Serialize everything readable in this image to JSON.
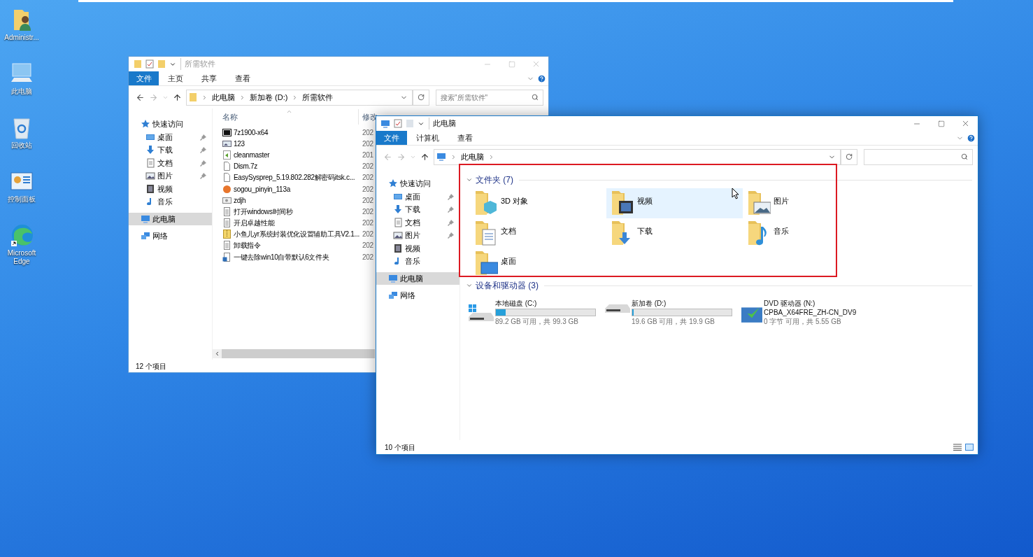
{
  "desktop_icons": [
    {
      "label": "Administr...",
      "kind": "user"
    },
    {
      "label": "此电脑",
      "kind": "computer"
    },
    {
      "label": "回收站",
      "kind": "trash"
    },
    {
      "label": "控制面板",
      "kind": "panel"
    },
    {
      "label": "Microsoft Edge",
      "kind": "edge"
    }
  ],
  "back_window": {
    "title": "所需软件",
    "active": false,
    "tabs": [
      {
        "label": "文件",
        "kind": "menu",
        "selected": false
      },
      {
        "label": "主页",
        "kind": "tab",
        "selected": false
      },
      {
        "label": "共享",
        "kind": "tab",
        "selected": false
      },
      {
        "label": "查看",
        "kind": "tab",
        "selected": false
      }
    ],
    "breadcrumb": [
      "此电脑",
      "新加卷 (D:)",
      "所需软件"
    ],
    "search_placeholder": "搜索\"所需软件\"",
    "nav": [
      {
        "label": "快速访问",
        "kind": "star",
        "selected": false,
        "children": [
          {
            "label": "桌面",
            "kind": "desktop",
            "pinned": true,
            "selected": false
          },
          {
            "label": "下载",
            "kind": "download",
            "pinned": true,
            "selected": false
          },
          {
            "label": "文档",
            "kind": "document",
            "pinned": true,
            "selected": false
          },
          {
            "label": "图片",
            "kind": "picture",
            "pinned": true,
            "selected": false
          },
          {
            "label": "视频",
            "kind": "video",
            "pinned": false,
            "selected": false
          },
          {
            "label": "音乐",
            "kind": "music",
            "pinned": false,
            "selected": false
          }
        ]
      },
      {
        "label": "此电脑",
        "kind": "computer",
        "selected": true
      },
      {
        "label": "网络",
        "kind": "network",
        "selected": false
      }
    ],
    "columns": [
      "名称",
      "修改"
    ],
    "files": [
      {
        "name": "7z1900-x64",
        "kind": "sevenzip",
        "date": "202"
      },
      {
        "name": "123",
        "kind": "image",
        "date": "202"
      },
      {
        "name": "cleanmaster",
        "kind": "installer",
        "date": "201"
      },
      {
        "name": "Dism.7z",
        "kind": "file",
        "date": "202"
      },
      {
        "name": "EasySysprep_5.19.802.282解密码itsk.c...",
        "kind": "file",
        "date": "202"
      },
      {
        "name": "sogou_pinyin_113a",
        "kind": "sogou",
        "date": "202"
      },
      {
        "name": "zdjh",
        "kind": "snapshot",
        "date": "202"
      },
      {
        "name": "打开windows时间秒",
        "kind": "text",
        "date": "202"
      },
      {
        "name": "开启卓越性能",
        "kind": "text",
        "date": "202"
      },
      {
        "name": "小鱼儿yr系统封装优化设置辅助工具V2.1...",
        "kind": "archive",
        "date": "202"
      },
      {
        "name": "卸载指令",
        "kind": "text",
        "date": "202"
      },
      {
        "name": "一键去除win10自带默认6文件夹",
        "kind": "script",
        "date": "202"
      }
    ],
    "status": "12 个项目"
  },
  "front_window": {
    "title": "此电脑",
    "active": true,
    "tabs": [
      {
        "label": "文件",
        "kind": "menu",
        "selected": false
      },
      {
        "label": "计算机",
        "kind": "tab",
        "selected": false
      },
      {
        "label": "查看",
        "kind": "tab",
        "selected": false
      }
    ],
    "breadcrumb": [
      "此电脑"
    ],
    "nav": [
      {
        "label": "快速访问",
        "kind": "star",
        "selected": false,
        "children": [
          {
            "label": "桌面",
            "kind": "desktop",
            "pinned": true,
            "selected": false
          },
          {
            "label": "下载",
            "kind": "download",
            "pinned": true,
            "selected": false
          },
          {
            "label": "文档",
            "kind": "document",
            "pinned": true,
            "selected": false
          },
          {
            "label": "图片",
            "kind": "picture",
            "pinned": true,
            "selected": false
          },
          {
            "label": "视频",
            "kind": "video",
            "pinned": false,
            "selected": false
          },
          {
            "label": "音乐",
            "kind": "music",
            "pinned": false,
            "selected": false
          }
        ]
      },
      {
        "label": "此电脑",
        "kind": "computer",
        "selected": true
      },
      {
        "label": "网络",
        "kind": "network",
        "selected": false
      }
    ],
    "folders_header": "文件夹 (7)",
    "folders": [
      {
        "label": "3D 对象",
        "kind": "cube",
        "highlighted": false
      },
      {
        "label": "视频",
        "kind": "video",
        "highlighted": true
      },
      {
        "label": "图片",
        "kind": "picture",
        "highlighted": false
      },
      {
        "label": "文档",
        "kind": "document",
        "highlighted": false
      },
      {
        "label": "下载",
        "kind": "download",
        "highlighted": false
      },
      {
        "label": "音乐",
        "kind": "music",
        "highlighted": false
      },
      {
        "label": "桌面",
        "kind": "desktop",
        "highlighted": false
      }
    ],
    "drives_header": "设备和驱动器 (3)",
    "drives": [
      {
        "label": "本地磁盘 (C:)",
        "kind": "system",
        "level": 0.1,
        "space": "89.2 GB 可用，共 99.3 GB"
      },
      {
        "label": "新加卷 (D:)",
        "kind": "drive",
        "level": 0.015,
        "space": "19.6 GB 可用，共 19.9 GB"
      },
      {
        "label": "DVD 驱动器 (N:)",
        "kind": "dvd",
        "volume": "CPBA_X64FRE_ZH-CN_DV9",
        "space": "0 字节 可用，共 5.55 GB"
      }
    ],
    "status": "10 个项目"
  }
}
